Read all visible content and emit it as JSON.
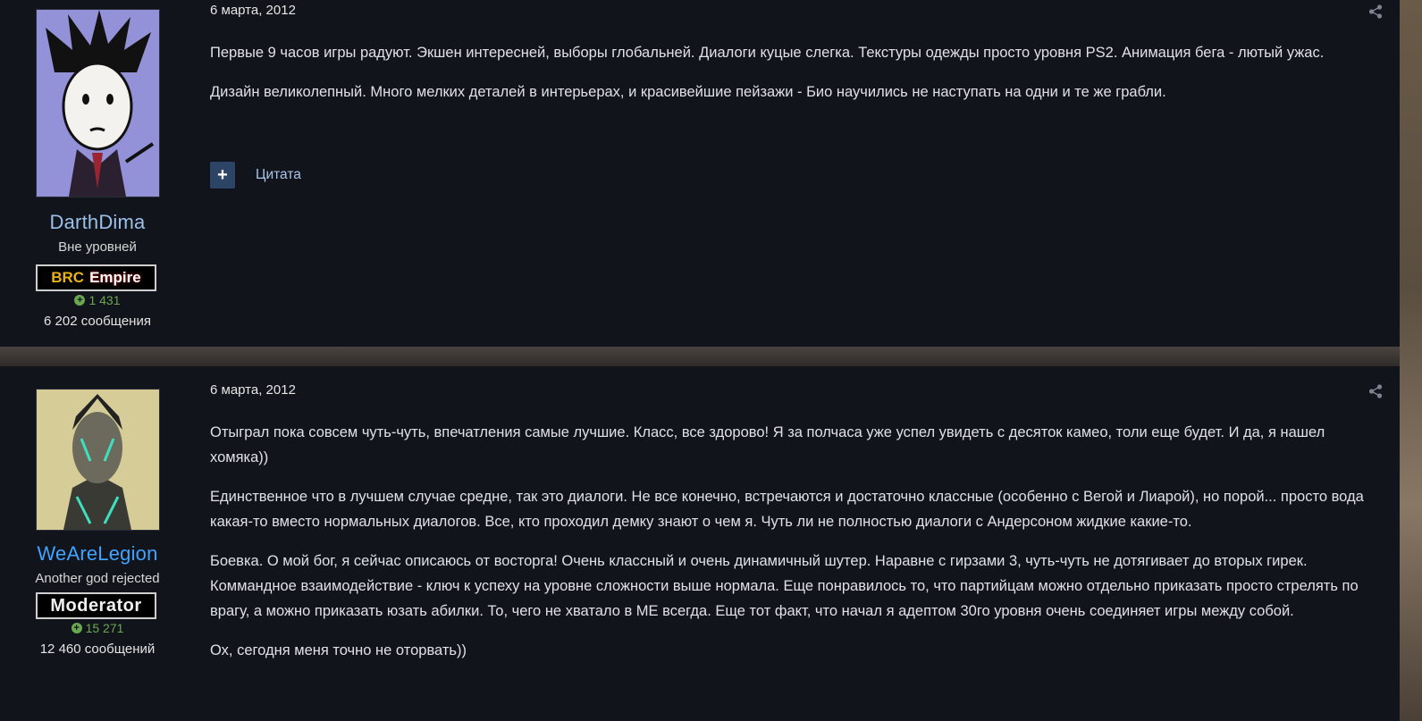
{
  "posts": [
    {
      "author": {
        "name": "DarthDima",
        "rank": "Вне уровней",
        "badge": {
          "part1": "BRC",
          "part2": "Empire"
        },
        "reputation": "1 431",
        "messages": "6 202 сообщения"
      },
      "date": "6 марта, 2012",
      "paragraphs": [
        "Первые 9 часов игры радуют. Экшен интересней, выборы глобальней. Диалоги куцые слегка. Текстуры одежды просто уровня PS2. Анимация бега - лютый ужас.",
        "Дизайн великолепный. Много мелких деталей в интерьерах, и красивейшие пейзажи - Био научились не наступать на одни и те же грабли."
      ],
      "actions": {
        "plus": "+",
        "quote": "Цитата"
      }
    },
    {
      "author": {
        "name": "WeAreLegion",
        "rank": "Another god rejected",
        "badge": {
          "label": "Moderator"
        },
        "reputation": "15 271",
        "messages": "12 460 сообщений"
      },
      "date": "6 марта, 2012",
      "paragraphs": [
        "Отыграл пока совсем чуть-чуть, впечатления самые лучшие. Класс, все здорово! Я за полчаса уже успел увидеть с десяток камео, толи еще будет. И да, я нашел хомяка))",
        "Единственное что в лучшем случае средне, так это диалоги. Не все конечно, встречаются и достаточно классные (особенно с Вегой и Лиарой), но порой... просто вода какая-то вместо нормальных диалогов. Все, кто проходил демку знают о чем я. Чуть ли не полностью диалоги с Андерсоном жидкие какие-то.",
        "Боевка. О мой бог, я сейчас описаюсь от восторга! Очень классный и очень динамичный шутер. Наравне с гирзами 3, чуть-чуть не дотягивает до вторых гирек. Коммандное взаимодействие - ключ к успеху на уровне сложности выше нормала. Еще понравилось то, что партийцам можно отдельно приказать просто стрелять по врагу, а можно приказать юзать абилки. То, чего не хватало в МЕ всегда. Еще тот факт, что начал я адептом 30го уровня очень соединяет игры между собой.",
        "Ох, сегодня меня точно не оторвать))"
      ]
    }
  ],
  "colors": {
    "post_bg": "#12141b",
    "username": "#9cc0e8",
    "moderator_name": "#3fa3ff",
    "reputation": "#6aa84f",
    "button_bg": "#2c4466",
    "link": "#a9c6ea"
  },
  "icons": [
    "share-icon",
    "plus-icon",
    "reputation-plus-icon"
  ]
}
